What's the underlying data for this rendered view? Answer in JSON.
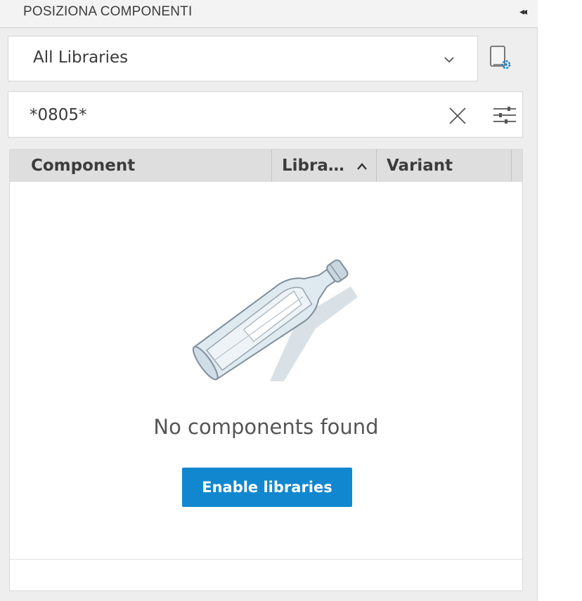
{
  "panel": {
    "title": "POSIZIONA COMPONENTI",
    "collapse_glyph": "◂◂"
  },
  "library_select": {
    "value": "All Libraries",
    "icon": "chevron-down-icon"
  },
  "library_settings": {
    "icon": "library-settings-icon"
  },
  "search": {
    "value": "*0805*",
    "clear_icon": "close-icon",
    "filter_icon": "filter-sliders-icon"
  },
  "table": {
    "columns": [
      {
        "label": "Component"
      },
      {
        "label": "Libra…"
      },
      {
        "label": "Variant"
      }
    ],
    "sort_icon": "chevron-up-icon"
  },
  "empty_state": {
    "illustration": "bottle-icon",
    "message": "No components found",
    "button_label": "Enable libraries"
  },
  "colors": {
    "accent": "#1187cf",
    "panel_bg": "#eeeeee",
    "header_bg": "#dedede"
  }
}
